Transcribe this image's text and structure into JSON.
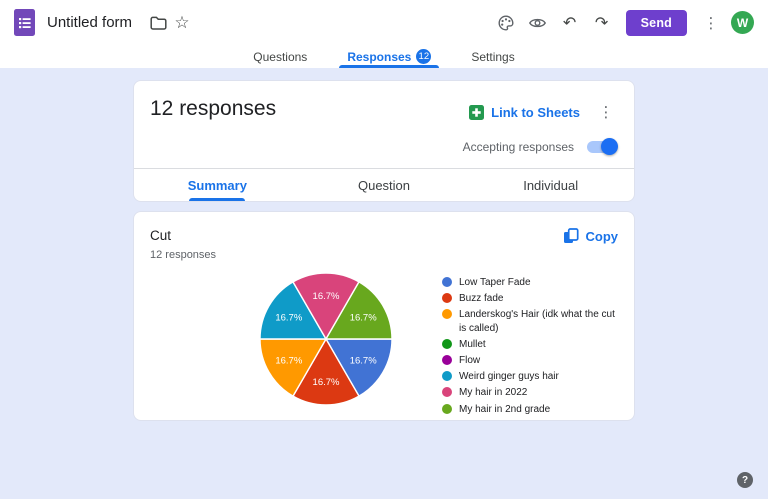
{
  "header": {
    "title": "Untitled form",
    "send_label": "Send",
    "avatar_letter": "W"
  },
  "icons": {
    "star": "☆",
    "undo": "↶",
    "redo": "↷",
    "more_vertical": "⋮",
    "help": "?"
  },
  "tabs": [
    {
      "label": "Questions",
      "active": false
    },
    {
      "label": "Responses",
      "badge": "12",
      "active": true
    },
    {
      "label": "Settings",
      "active": false
    }
  ],
  "responses_card": {
    "title": "12 responses",
    "link_to_sheets_label": "Link to Sheets",
    "accepting_label": "Accepting responses",
    "accepting_on": true,
    "subtabs": [
      {
        "label": "Summary",
        "active": true
      },
      {
        "label": "Question",
        "active": false
      },
      {
        "label": "Individual",
        "active": false
      }
    ]
  },
  "chart_card": {
    "question_title": "Cut",
    "responses_label": "12 responses",
    "copy_label": "Copy"
  },
  "chart_data": {
    "type": "pie",
    "title": "Cut",
    "total_responses": 12,
    "legend_position": "right",
    "start_angle_deg": 90,
    "categories": [
      "Low Taper Fade",
      "Buzz fade",
      "Landerskog's Hair (idk what the cut is called)",
      "Mullet",
      "Flow",
      "Weird ginger guys hair",
      "My hair in 2022",
      "My hair in 2nd grade"
    ],
    "values": [
      2,
      2,
      2,
      0,
      0,
      2,
      2,
      2
    ],
    "percent_labels": [
      "16.7%",
      "16.7%",
      "16.7%",
      "",
      "",
      "16.7%",
      "16.7%",
      "16.7%"
    ],
    "colors": [
      "#4173d4",
      "#dc3912",
      "#ff9900",
      "#109618",
      "#990099",
      "#0f9bc8",
      "#d9447b",
      "#68a81e"
    ]
  },
  "accent_colors": {
    "blue": "#1a73e8",
    "send_purple": "#6e3fcd",
    "forms_purple": "#7248b9",
    "avatar_green": "#34a853",
    "sheets_green": "#23994f",
    "background": "#e3e9fa"
  }
}
